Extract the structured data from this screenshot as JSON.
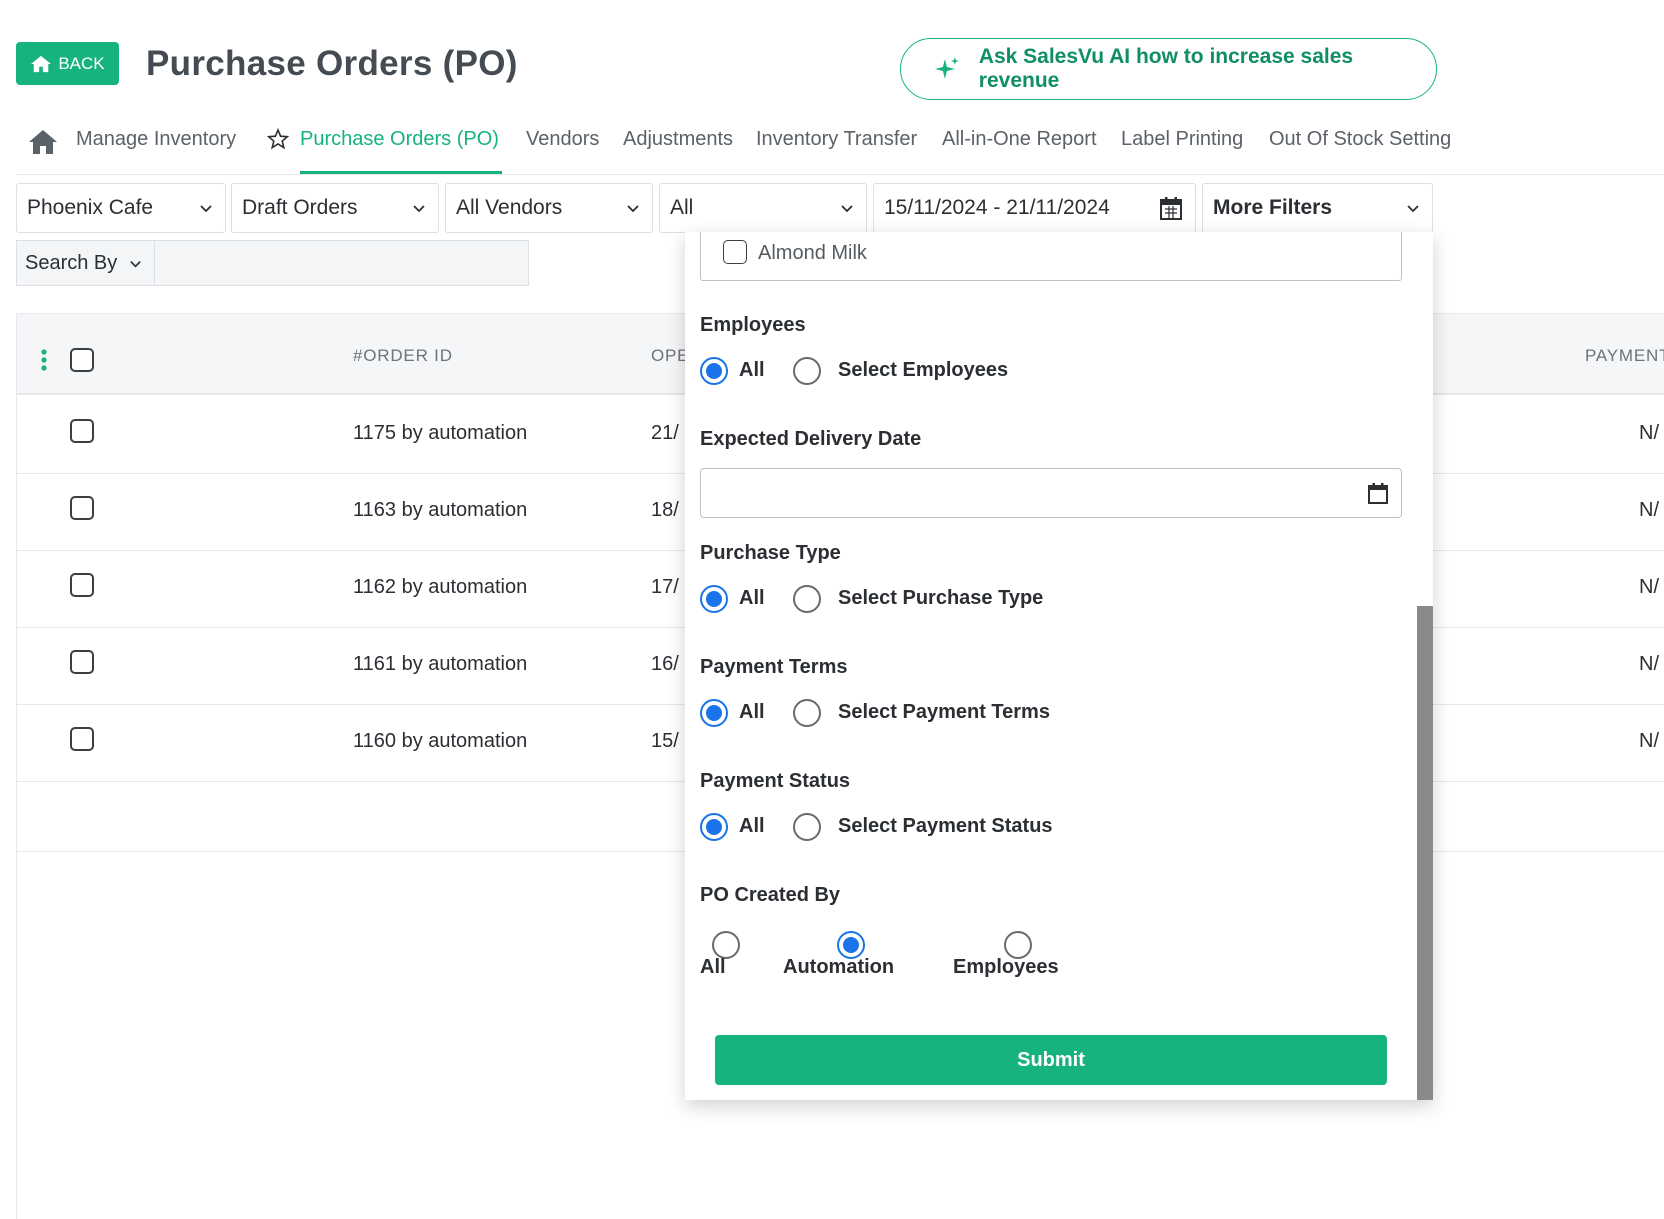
{
  "header": {
    "back_label": "BACK",
    "title": "Purchase Orders (PO)",
    "ai_button_label": "Ask SalesVu AI how to increase sales revenue"
  },
  "nav": {
    "items": [
      {
        "label": "Manage Inventory"
      },
      {
        "label": "Purchase Orders (PO)",
        "active": true
      },
      {
        "label": "Vendors"
      },
      {
        "label": "Adjustments"
      },
      {
        "label": "Inventory Transfer"
      },
      {
        "label": "All-in-One Report"
      },
      {
        "label": "Label Printing"
      },
      {
        "label": "Out Of Stock Setting"
      }
    ]
  },
  "filters": {
    "location": "Phoenix Cafe",
    "order_type": "Draft Orders",
    "vendor": "All Vendors",
    "status": "All",
    "date_range": "15/11/2024 - 21/11/2024",
    "more_filters": "More Filters",
    "search_by": "Search By",
    "search_value": ""
  },
  "table": {
    "headers": {
      "order_id": "#ORDER ID",
      "opened": "OPE",
      "payment": "PAYMENT"
    },
    "rows": [
      {
        "order_id": "1175 by automation",
        "opened": "21/",
        "payment": "N/"
      },
      {
        "order_id": "1163 by automation",
        "opened": "18/",
        "payment": "N/"
      },
      {
        "order_id": "1162 by automation",
        "opened": "17/",
        "payment": "N/"
      },
      {
        "order_id": "1161 by automation",
        "opened": "16/",
        "payment": "N/"
      },
      {
        "order_id": "1160 by automation",
        "opened": "15/",
        "payment": "N/"
      }
    ]
  },
  "panel": {
    "item_label": "Almond Milk",
    "employees": {
      "title": "Employees",
      "opt_all": "All",
      "opt_select": "Select Employees",
      "selected": "All"
    },
    "delivery": {
      "title": "Expected Delivery Date",
      "value": ""
    },
    "purchase_type": {
      "title": "Purchase Type",
      "opt_all": "All",
      "opt_select": "Select Purchase Type",
      "selected": "All"
    },
    "payment_terms": {
      "title": "Payment Terms",
      "opt_all": "All",
      "opt_select": "Select Payment Terms",
      "selected": "All"
    },
    "payment_status": {
      "title": "Payment Status",
      "opt_all": "All",
      "opt_select": "Select Payment Status",
      "selected": "All"
    },
    "created_by": {
      "title": "PO Created By",
      "opt_all": "All",
      "opt_automation": "Automation",
      "opt_employees": "Employees",
      "selected": "Automation"
    },
    "submit_label": "Submit"
  },
  "colors": {
    "brand_green": "#16b37d",
    "radio_blue": "#1a73e8"
  }
}
